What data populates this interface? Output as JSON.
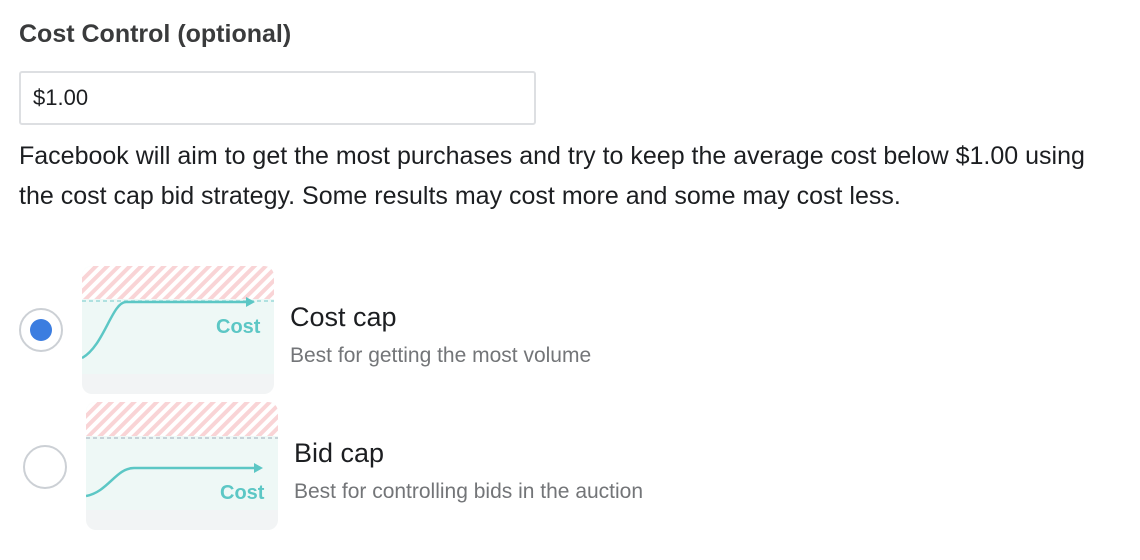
{
  "section": {
    "title": "Cost Control (optional)"
  },
  "cost_input": {
    "value": "$1.00"
  },
  "description": "Facebook will aim to get the most purchases and try to keep the average cost below $1.00 using the cost cap bid strategy. Some results may cost more and some may cost less.",
  "bid_strategies": [
    {
      "title": "Cost cap",
      "subtitle": "Best for getting the most volume",
      "thumb_label": "Cost",
      "selected": true
    },
    {
      "title": "Bid cap",
      "subtitle": "Best for controlling bids in the auction",
      "thumb_label": "Cost",
      "selected": false
    }
  ],
  "colors": {
    "accent": "#3b7de0",
    "chart_line": "#5cc7c5",
    "chart_bg": "#eef8f6",
    "hatch": "#f9d4d6",
    "muted_text": "#737578"
  },
  "icons": {
    "cost_cap_thumb": "cost-cap-chart-icon",
    "bid_cap_thumb": "bid-cap-chart-icon"
  }
}
